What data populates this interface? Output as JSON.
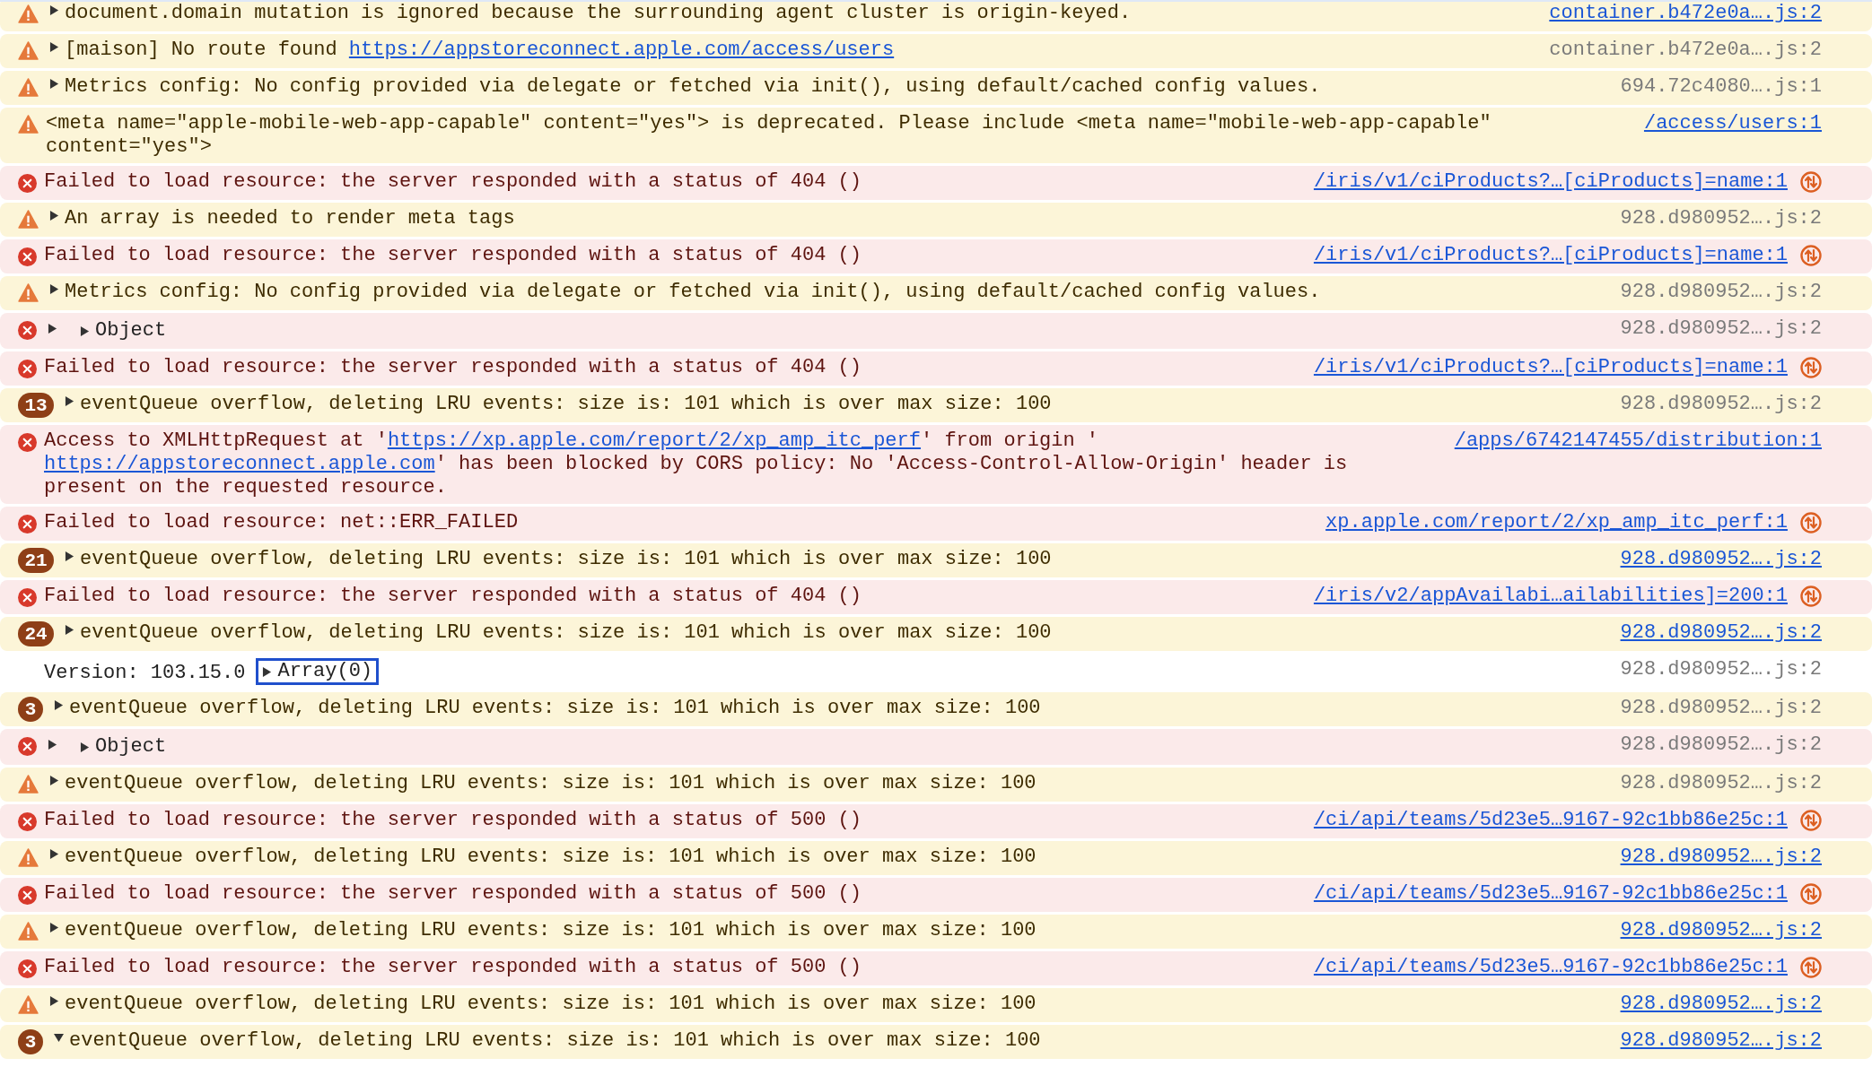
{
  "console": {
    "messages": [
      {
        "kind": "warning",
        "expanded": false,
        "parts": [
          {
            "kind": "text",
            "text": "document.domain mutation is ignored because the surrounding agent cluster is origin-keyed."
          }
        ],
        "source": {
          "text": "container.b472e0a….js:2",
          "link": true,
          "network": false
        }
      },
      {
        "kind": "warning",
        "expanded": false,
        "parts": [
          {
            "kind": "text",
            "text": "[maison] No route found "
          },
          {
            "kind": "link",
            "text": "https://appstoreconnect.apple.com/access/users"
          }
        ],
        "source": {
          "text": "container.b472e0a….js:2",
          "link": false,
          "network": false
        }
      },
      {
        "kind": "warning",
        "expanded": false,
        "parts": [
          {
            "kind": "text",
            "text": "Metrics config: No config provided via delegate or fetched via init(), using default/cached config values."
          }
        ],
        "source": {
          "text": "694.72c4080….js:1",
          "link": false,
          "network": false
        }
      },
      {
        "kind": "warning",
        "parts": [
          {
            "kind": "text",
            "text": "<meta name=\"apple-mobile-web-app-capable\" content=\"yes\"> is deprecated. Please include <meta name=\"mobile-web-app-capable\" content=\"yes\">"
          }
        ],
        "source": {
          "text": "/access/users:1",
          "link": true,
          "network": false
        }
      },
      {
        "kind": "error",
        "parts": [
          {
            "kind": "text",
            "text": "Failed to load resource: the server responded with a status of 404 ()"
          }
        ],
        "source": {
          "text": "/iris/v1/ciProducts?…[ciProducts]=name:1",
          "link": true,
          "network": true
        }
      },
      {
        "kind": "warning",
        "expanded": false,
        "parts": [
          {
            "kind": "text",
            "text": "An array is needed to render meta tags"
          }
        ],
        "source": {
          "text": "928.d980952….js:2",
          "link": false,
          "network": false
        }
      },
      {
        "kind": "error",
        "parts": [
          {
            "kind": "text",
            "text": "Failed to load resource: the server responded with a status of 404 ()"
          }
        ],
        "source": {
          "text": "/iris/v1/ciProducts?…[ciProducts]=name:1",
          "link": true,
          "network": true
        }
      },
      {
        "kind": "warning",
        "expanded": false,
        "parts": [
          {
            "kind": "text",
            "text": "Metrics config: No config provided via delegate or fetched via init(), using default/cached config values."
          }
        ],
        "source": {
          "text": "928.d980952….js:2",
          "link": false,
          "network": false
        }
      },
      {
        "kind": "error",
        "expanded": false,
        "parts": [
          {
            "kind": "object",
            "text": "Object",
            "expanded": false,
            "focused": false
          }
        ],
        "source": {
          "text": "928.d980952….js:2",
          "link": false,
          "network": false
        }
      },
      {
        "kind": "error",
        "parts": [
          {
            "kind": "text",
            "text": "Failed to load resource: the server responded with a status of 404 ()"
          }
        ],
        "source": {
          "text": "/iris/v1/ciProducts?…[ciProducts]=name:1",
          "link": true,
          "network": true
        }
      },
      {
        "kind": "warning",
        "count": "13",
        "expanded": false,
        "parts": [
          {
            "kind": "text",
            "text": "eventQueue overflow, deleting LRU events: size is: 101 which is over max size: 100"
          }
        ],
        "source": {
          "text": "928.d980952….js:2",
          "link": false,
          "network": false
        }
      },
      {
        "kind": "error",
        "parts": [
          {
            "kind": "text",
            "text": "Access to XMLHttpRequest at '"
          },
          {
            "kind": "link",
            "text": "https://xp.apple.com/report/2/xp_amp_itc_perf"
          },
          {
            "kind": "text",
            "text": "' from origin '"
          },
          {
            "kind": "link",
            "text": "https://appstoreconnect.apple.com"
          },
          {
            "kind": "text",
            "text": "' has been blocked by CORS policy: No 'Access-Control-Allow-Origin' header is present on the requested resource."
          }
        ],
        "source": {
          "text": "/apps/6742147455/distribution:1",
          "link": true,
          "network": false
        }
      },
      {
        "kind": "error",
        "parts": [
          {
            "kind": "text",
            "text": "Failed to load resource: net::ERR_FAILED"
          }
        ],
        "source": {
          "text": "xp.apple.com/report/2/xp_amp_itc_perf:1",
          "link": true,
          "network": true
        }
      },
      {
        "kind": "warning",
        "count": "21",
        "expanded": false,
        "parts": [
          {
            "kind": "text",
            "text": "eventQueue overflow, deleting LRU events: size is: 101 which is over max size: 100"
          }
        ],
        "source": {
          "text": "928.d980952….js:2",
          "link": true,
          "network": false
        }
      },
      {
        "kind": "error",
        "parts": [
          {
            "kind": "text",
            "text": "Failed to load resource: the server responded with a status of 404 ()"
          }
        ],
        "source": {
          "text": "/iris/v2/appAvailabi…ailabilities]=200:1",
          "link": true,
          "network": true
        }
      },
      {
        "kind": "warning",
        "count": "24",
        "expanded": false,
        "parts": [
          {
            "kind": "text",
            "text": "eventQueue overflow, deleting LRU events: size is: 101 which is over max size: 100"
          }
        ],
        "source": {
          "text": "928.d980952….js:2",
          "link": true,
          "network": false
        }
      },
      {
        "kind": "info",
        "parts": [
          {
            "kind": "text",
            "text": "Version: 103.15.0"
          },
          {
            "kind": "object",
            "text": "Array(0)",
            "expanded": false,
            "focused": true
          }
        ],
        "source": {
          "text": "928.d980952….js:2",
          "link": false,
          "network": false
        }
      },
      {
        "kind": "warning",
        "count": "3",
        "expanded": false,
        "parts": [
          {
            "kind": "text",
            "text": "eventQueue overflow, deleting LRU events: size is: 101 which is over max size: 100"
          }
        ],
        "source": {
          "text": "928.d980952….js:2",
          "link": false,
          "network": false
        }
      },
      {
        "kind": "error",
        "expanded": false,
        "parts": [
          {
            "kind": "object",
            "text": "Object",
            "expanded": false,
            "focused": false
          }
        ],
        "source": {
          "text": "928.d980952….js:2",
          "link": false,
          "network": false
        }
      },
      {
        "kind": "warning",
        "expanded": false,
        "parts": [
          {
            "kind": "text",
            "text": "eventQueue overflow, deleting LRU events: size is: 101 which is over max size: 100"
          }
        ],
        "source": {
          "text": "928.d980952….js:2",
          "link": false,
          "network": false
        }
      },
      {
        "kind": "error",
        "parts": [
          {
            "kind": "text",
            "text": "Failed to load resource: the server responded with a status of 500 ()"
          }
        ],
        "source": {
          "text": "/ci/api/teams/5d23e5…9167-92c1bb86e25c:1",
          "link": true,
          "network": true
        }
      },
      {
        "kind": "warning",
        "expanded": false,
        "parts": [
          {
            "kind": "text",
            "text": "eventQueue overflow, deleting LRU events: size is: 101 which is over max size: 100"
          }
        ],
        "source": {
          "text": "928.d980952….js:2",
          "link": true,
          "network": false
        }
      },
      {
        "kind": "error",
        "parts": [
          {
            "kind": "text",
            "text": "Failed to load resource: the server responded with a status of 500 ()"
          }
        ],
        "source": {
          "text": "/ci/api/teams/5d23e5…9167-92c1bb86e25c:1",
          "link": true,
          "network": true
        }
      },
      {
        "kind": "warning",
        "expanded": false,
        "parts": [
          {
            "kind": "text",
            "text": "eventQueue overflow, deleting LRU events: size is: 101 which is over max size: 100"
          }
        ],
        "source": {
          "text": "928.d980952….js:2",
          "link": true,
          "network": false
        }
      },
      {
        "kind": "error",
        "parts": [
          {
            "kind": "text",
            "text": "Failed to load resource: the server responded with a status of 500 ()"
          }
        ],
        "source": {
          "text": "/ci/api/teams/5d23e5…9167-92c1bb86e25c:1",
          "link": true,
          "network": true
        }
      },
      {
        "kind": "warning",
        "expanded": false,
        "parts": [
          {
            "kind": "text",
            "text": "eventQueue overflow, deleting LRU events: size is: 101 which is over max size: 100"
          }
        ],
        "source": {
          "text": "928.d980952….js:2",
          "link": true,
          "network": false
        }
      },
      {
        "kind": "warning",
        "count": "3",
        "expanded": true,
        "parts": [
          {
            "kind": "text",
            "text": "eventQueue overflow, deleting LRU events: size is: 101 which is over max size: 100"
          }
        ],
        "source": {
          "text": "928.d980952….js:2",
          "link": true,
          "network": false
        }
      }
    ]
  }
}
